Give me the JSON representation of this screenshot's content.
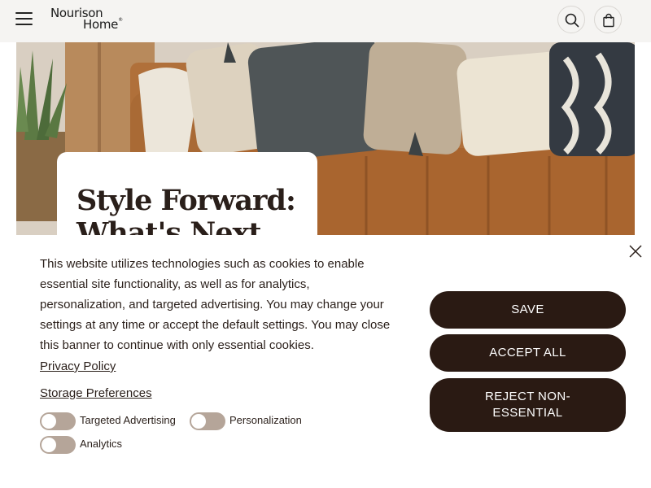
{
  "header": {
    "logo_line1": "Nourison",
    "logo_line2": "Home",
    "logo_mark": "®",
    "menu_icon": "hamburger-menu-icon",
    "search_icon": "search-icon",
    "bag_icon": "shopping-bag-icon"
  },
  "hero": {
    "title": "Style Forward: What's Next"
  },
  "cookie_banner": {
    "text": "This website utilizes technologies such as cookies to enable essential site functionality, as well as for analytics, personalization, and targeted advertising. You may change your settings at any time or accept the default settings. You may close this banner to continue with only essential cookies.",
    "privacy_link": "Privacy Policy",
    "storage_link": "Storage Preferences",
    "toggles": [
      {
        "label": "Targeted Advertising",
        "enabled": false
      },
      {
        "label": "Personalization",
        "enabled": false
      },
      {
        "label": "Analytics",
        "enabled": false
      }
    ],
    "buttons": {
      "save": "SAVE",
      "accept_all": "ACCEPT ALL",
      "reject": "REJECT NON-ESSENTIAL"
    },
    "close_icon": "close-icon"
  },
  "colors": {
    "button_bg": "#2a1a13",
    "toggle_off": "#b5a599",
    "header_bg": "#f5f4f2"
  }
}
